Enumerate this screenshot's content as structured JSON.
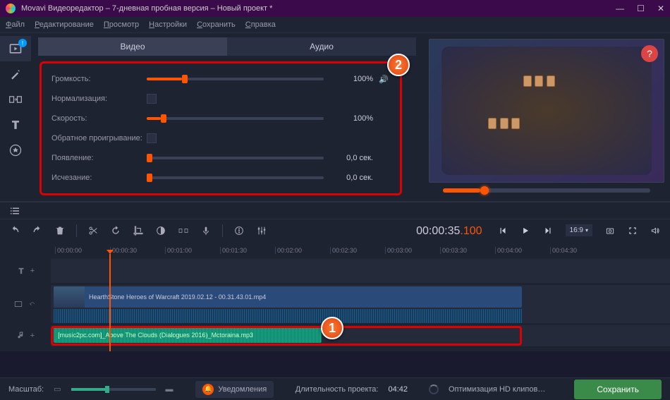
{
  "window": {
    "title": "Movavi Видеоредактор – 7-дневная пробная версия – Новый проект *",
    "min": "—",
    "max": "☐",
    "close": "✕"
  },
  "menu": {
    "file": "Файл",
    "edit": "Редактирование",
    "view": "Просмотр",
    "settings": "Настройки",
    "save": "Сохранить",
    "help": "Справка"
  },
  "tabs": {
    "video": "Видео",
    "audio": "Аудио"
  },
  "props": {
    "volume_label": "Громкость:",
    "volume_val": "100%",
    "normalize_label": "Нормализация:",
    "speed_label": "Скорость:",
    "speed_val": "100%",
    "reverse_label": "Обратное проигрывание:",
    "fadein_label": "Появление:",
    "fadein_val": "0,0 сек.",
    "fadeout_label": "Исчезание:",
    "fadeout_val": "0,0 сек."
  },
  "callout1": "1",
  "callout2": "2",
  "help": "?",
  "timecode": {
    "main": "00:00:",
    "sec": "35",
    "ms": ".100"
  },
  "ratio": "16:9",
  "ruler": {
    "t0": "00:00:00",
    "t1": "00:00:30",
    "t2": "00:01:00",
    "t3": "00:01:30",
    "t4": "00:02:00",
    "t5": "00:02:30",
    "t6": "00:03:00",
    "t7": "00:03:30",
    "t8": "00:04:00",
    "t9": "00:04:30"
  },
  "clips": {
    "video_name": "HearthStone  Heroes of Warcraft 2019.02.12 - 00.31.43.01.mp4",
    "audio_name": "[music2pc.com]_Above The Clouds (Dialogues 2016)_Mctoraina.mp3"
  },
  "status": {
    "zoom_label": "Масштаб:",
    "notif": "Уведомления",
    "duration_label": "Длительность проекта:",
    "duration_val": "04:42",
    "optimize": "Оптимизация HD клипов…",
    "save_btn": "Сохранить"
  },
  "sidebar_badge": "!"
}
